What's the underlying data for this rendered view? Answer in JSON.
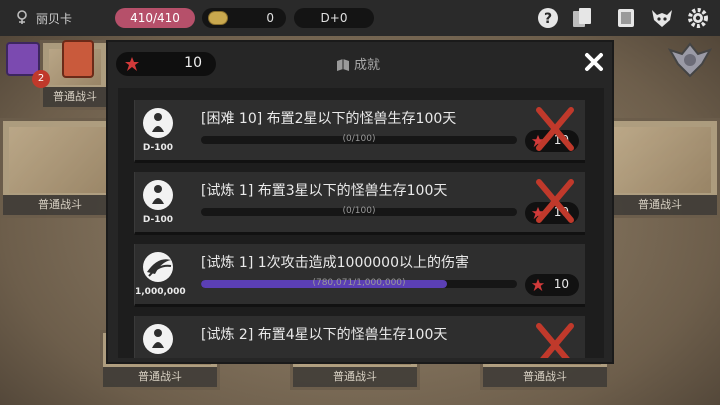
{
  "topbar": {
    "player_name": "丽贝卡",
    "hp": "410/410",
    "coins": "0",
    "difficulty": "D+0"
  },
  "side": {
    "chest_badge": "2"
  },
  "board": {
    "cards": [
      {
        "label": "普通战斗"
      },
      {
        "label": "普通战斗"
      },
      {
        "label": "普通战斗"
      },
      {
        "label": "普通战斗"
      },
      {
        "label": "普通战斗"
      },
      {
        "label": "普通战斗"
      }
    ]
  },
  "modal": {
    "score": "10",
    "title": "成就",
    "achievements": [
      {
        "badge_label": "D-100",
        "badge_icon": "star-figure-icon",
        "title": "[困难 10] 布置2星以下的怪兽生存100天",
        "progress_text": "(0/100)",
        "progress": 0,
        "reward": "10",
        "completed_mark": true
      },
      {
        "badge_label": "D-100",
        "badge_icon": "star-figure-icon",
        "title": "[试炼 1] 布置3星以下的怪兽生存100天",
        "progress_text": "(0/100)",
        "progress": 0,
        "reward": "10",
        "completed_mark": true
      },
      {
        "badge_label": "1,000,000",
        "badge_icon": "claw-strike-icon",
        "title": "[试炼 1] 1次攻击造成1000000以上的伤害",
        "progress_text": "(780,071/1,000,000)",
        "progress": 0.78,
        "reward": "10",
        "completed_mark": false
      },
      {
        "badge_label": "",
        "badge_icon": "star-figure-icon",
        "title": "[试炼 2] 布置4星以下的怪兽生存100天",
        "progress_text": "",
        "progress": 0,
        "reward": "",
        "completed_mark": true
      }
    ]
  },
  "colors": {
    "hp_pill": "#b6506a",
    "progress_fill": "#5b3fb5",
    "x_mark": "#c0392b"
  }
}
